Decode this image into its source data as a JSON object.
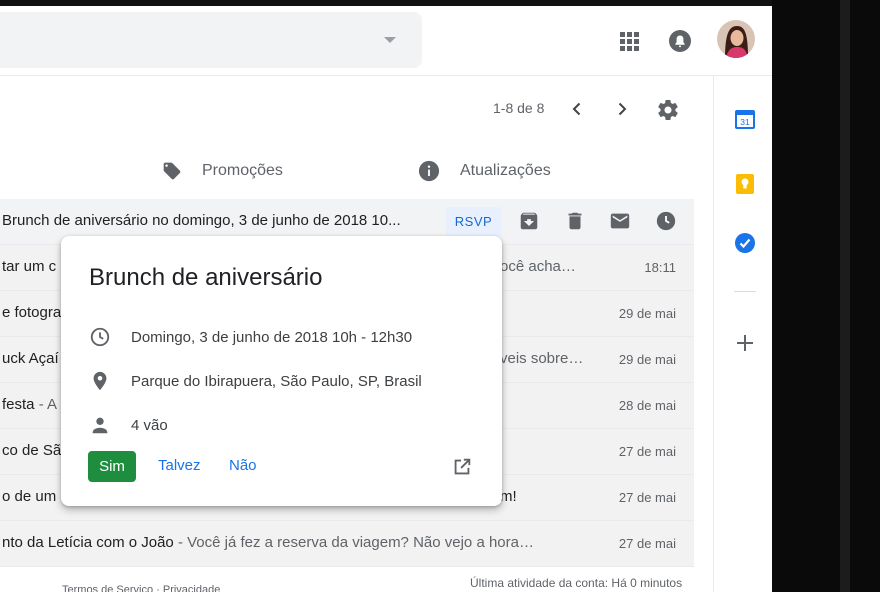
{
  "header": {
    "apps_icon": "apps-grid-icon",
    "notifications_icon": "bell-icon",
    "avatar": "account-avatar"
  },
  "toolbar": {
    "pager": "1-8 de 8"
  },
  "tabs": [
    {
      "label": "Promoções",
      "icon": "tag-icon"
    },
    {
      "label": "Atualizações",
      "icon": "info-icon"
    }
  ],
  "emails": [
    {
      "subject": "Brunch de aniversário no domingo, 3 de junho de 2018 10...",
      "snippet": "",
      "date": "",
      "rsvp": "RSVP"
    },
    {
      "subject": "tar um c",
      "snippet": "ocê acha…",
      "date": "18:11"
    },
    {
      "subject": "e fotogra",
      "snippet": "",
      "date": "29 de mai"
    },
    {
      "subject": "uck Açaí",
      "snippet": "veis sobre…",
      "date": "29 de mai"
    },
    {
      "subject": "festa",
      "snippet": " - A",
      "date": "28 de mai"
    },
    {
      "subject": "co de São",
      "snippet": "",
      "date": "27 de mai"
    },
    {
      "subject": "o de um",
      "snippet": "m!",
      "date": "27 de mai"
    },
    {
      "subject": "nto da Letícia com o João",
      "snippet": " - Você já fez a reserva da viagem? Não vejo a hora…",
      "date": "27 de mai"
    }
  ],
  "footer": {
    "links": "Termos de Serviço · Privacidade",
    "activity": "Última atividade da conta: Há 0 minutos"
  },
  "event_popup": {
    "title": "Brunch de aniversário",
    "datetime": "Domingo, 3 de junho de 2018 10h - 12h30",
    "location": "Parque do Ibirapuera, São Paulo, SP, Brasil",
    "guests": "4 vão",
    "yes": "Sim",
    "maybe": "Talvez",
    "no": "Não"
  },
  "side_panel": {
    "calendar_label": "31",
    "items": [
      "calendar-icon",
      "keep-icon",
      "tasks-icon",
      "add-icon"
    ]
  },
  "colors": {
    "primary_blue": "#1a73e8",
    "green_button": "#1e8e3e",
    "rsvp_bg": "#e8f0fe",
    "keep_yellow": "#fbbc04",
    "tasks_blue": "#1a73e8"
  }
}
